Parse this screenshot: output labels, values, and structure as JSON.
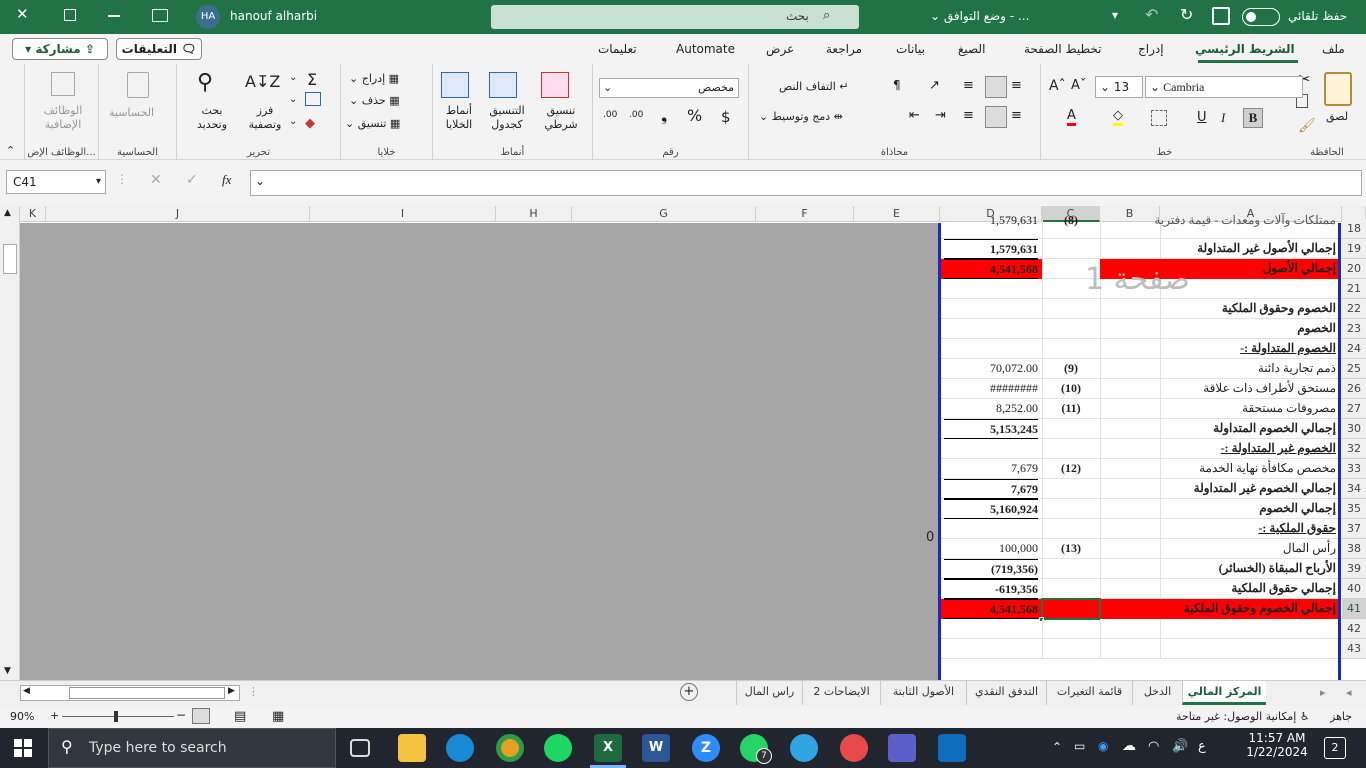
{
  "titlebar": {
    "autosave_label": "حفظ تلقائي",
    "doc_title": "وضع التوافق",
    "search_placeholder": "بحث",
    "user_name": "hanouf alharbi",
    "avatar_initials": "HA",
    "bar_color": "#217346"
  },
  "ribbon_tabs": [
    "ملف",
    "الشريط الرئيسي",
    "إدراج",
    "تخطيط الصفحة",
    "الصيغ",
    "بيانات",
    "مراجعة",
    "عرض",
    "Automate",
    "تعليمات"
  ],
  "share_label": "مشاركة",
  "comments_label": "التعليقات",
  "groups": {
    "clipboard": {
      "label": "الحافظة",
      "paste": "لصق"
    },
    "font": {
      "label": "خط",
      "font_name": "Cambria",
      "font_size": "13"
    },
    "alignment": {
      "label": "محاذاة",
      "wrap": "التفاف النص",
      "merge": "دمج وتوسيط"
    },
    "number": {
      "label": "رقم",
      "format": "مخصص"
    },
    "styles": {
      "label": "أنماط",
      "cond": "تنسيق شرطي",
      "table": "التنسيق كجدول",
      "cell": "أنماط الخلايا"
    },
    "cells": {
      "label": "خلايا",
      "insert": "إدراج",
      "delete": "حذف",
      "format": "تنسيق"
    },
    "editing": {
      "label": "تحرير",
      "sort": "فرز وتصفية",
      "find": "بحث وتحديد"
    },
    "sensitivity": {
      "label": "الحساسية",
      "btn": "الحساسية"
    },
    "addins": {
      "label": "الوظائف الإض...",
      "btn": "الوظائف الإضافية"
    }
  },
  "namebox": "C41",
  "fx": "fx",
  "columns": [
    "K",
    "J",
    "I",
    "H",
    "G",
    "F",
    "E",
    "D",
    "C",
    "B",
    "A"
  ],
  "watermark_page": "صفحة 1",
  "stray_zero": "0",
  "rows": [
    {
      "n": "18",
      "a": "ممتلكات وآلات ومعدات - قيمة دفترية",
      "c": "(8)",
      "d": "1,579,631",
      "style": "partial"
    },
    {
      "n": "19",
      "a": "إجمالي الأصول غير المتداولة",
      "c": "",
      "d": "1,579,631",
      "style": "bold"
    },
    {
      "n": "20",
      "a": "إجمالي الأصول",
      "c": "",
      "d": "4,541,568",
      "style": "red"
    },
    {
      "n": "21",
      "a": "",
      "c": "",
      "d": "",
      "style": ""
    },
    {
      "n": "22",
      "a": "الخصوم وحقوق الملكية",
      "c": "",
      "d": "",
      "style": "bold"
    },
    {
      "n": "23",
      "a": "الخصوم",
      "c": "",
      "d": "",
      "style": "bold"
    },
    {
      "n": "24",
      "a": "الخصوم المتداولة :-",
      "c": "",
      "d": "",
      "style": "boldu"
    },
    {
      "n": "25",
      "a": "ذمم تجارية دائنة",
      "c": "(9)",
      "d": "70,072.00",
      "style": ""
    },
    {
      "n": "26",
      "a": "مستحق لأطراف ذات علاقة",
      "c": "(10)",
      "d": "########",
      "style": ""
    },
    {
      "n": "27",
      "a": "مصروفات مستحقة",
      "c": "(11)",
      "d": "8,252.00",
      "style": ""
    },
    {
      "n": "30",
      "a": "إجمالي الخصوم المتداولة",
      "c": "",
      "d": "5,153,245",
      "style": "bold"
    },
    {
      "n": "32",
      "a": "الخصوم غير المتداولة :-",
      "c": "",
      "d": "",
      "style": "boldu"
    },
    {
      "n": "33",
      "a": "مخصص مكافأة نهاية الخدمة",
      "c": "(12)",
      "d": "7,679",
      "style": ""
    },
    {
      "n": "34",
      "a": "إجمالي الخصوم غير المتداولة",
      "c": "",
      "d": "7,679",
      "style": "bold"
    },
    {
      "n": "35",
      "a": "إجمالي الخصوم",
      "c": "",
      "d": "5,160,924",
      "style": "bold"
    },
    {
      "n": "37",
      "a": "حقوق الملكية :-",
      "c": "",
      "d": "",
      "style": "boldu"
    },
    {
      "n": "38",
      "a": "رأس المال",
      "c": "(13)",
      "d": "100,000",
      "style": ""
    },
    {
      "n": "39",
      "a": "الأرباح المبقاة (الخسائر)",
      "c": "",
      "d": "(719,356)",
      "style": "bold"
    },
    {
      "n": "40",
      "a": "إجمالي حقوق الملكية",
      "c": "",
      "d": "-619,356",
      "style": "bold"
    },
    {
      "n": "41",
      "a": "إجمالي الخصوم وحقوق الملكية",
      "c": "",
      "d": "4,541,568",
      "style": "red"
    },
    {
      "n": "42",
      "a": "",
      "c": "",
      "d": "",
      "style": ""
    },
    {
      "n": "43",
      "a": "",
      "c": "",
      "d": "",
      "style": ""
    }
  ],
  "sheet_tabs": [
    "المركز المالي",
    "الدخل",
    "قائمة التغيرات",
    "التدفق النقدي",
    "الأصول الثابتة",
    "الايضاحات 2",
    "راس المال"
  ],
  "status": {
    "ready": "جاهز",
    "accessibility": "إمكانية الوصول: غير متاحة",
    "zoom": "90%"
  },
  "taskbar": {
    "search_placeholder": "Type here to search",
    "time": "11:57 AM",
    "date": "1/22/2024",
    "lang": "ع",
    "notif_count": "2",
    "whatsapp_badge": "7"
  },
  "colors": {
    "red": "#ff0000",
    "excel_green": "#217346",
    "gray_area": "#a6a6a6",
    "print_border": "#1a27c9"
  }
}
